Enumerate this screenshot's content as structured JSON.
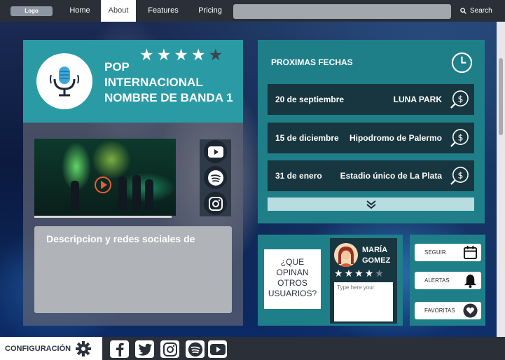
{
  "navbar": {
    "logo": "Logo",
    "links": [
      {
        "label": "Home"
      },
      {
        "label": "About",
        "active": true
      },
      {
        "label": "Features"
      },
      {
        "label": "Pricing"
      }
    ],
    "search_placeholder": "",
    "search_label": "Search"
  },
  "band": {
    "title_line1": "POP",
    "title_line2": "INTERNACIONAL",
    "title_line3": "NOMBRE DE BANDA 1",
    "rating": 4,
    "rating_max": 5,
    "description": "Descripcion y redes sociales de",
    "socials": [
      "youtube-icon",
      "spotify-icon",
      "instagram-icon"
    ]
  },
  "dates": {
    "title": "PROXIMAS FECHAS",
    "items": [
      {
        "date": "20 de septiembre",
        "venue": "LUNA PARK"
      },
      {
        "date": "15 de diciembre",
        "venue": "Hipodromo de Palermo"
      },
      {
        "date": "31 de enero",
        "venue": "Estadio único de La Plata"
      }
    ]
  },
  "reviews": {
    "question": "¿QUE OPINAN OTROS USUARIOS?",
    "user_first": "MARÍA",
    "user_last": "GOMEZ",
    "user_rating": 4,
    "input_placeholder": "Type here your"
  },
  "actions": {
    "follow": "SEGUIR",
    "alerts": "ALERTAS",
    "favorites": "FAVORITAS"
  },
  "footer": {
    "config": "CONFIGURACIÓN",
    "socials": [
      "facebook-icon",
      "twitter-icon",
      "instagram-icon",
      "spotify-icon",
      "youtube-icon"
    ]
  },
  "colors": {
    "teal": "#2a9ba5",
    "teal_dark": "#1f7f89",
    "row_dark": "#18363f",
    "navbar": "#2b2f38"
  }
}
